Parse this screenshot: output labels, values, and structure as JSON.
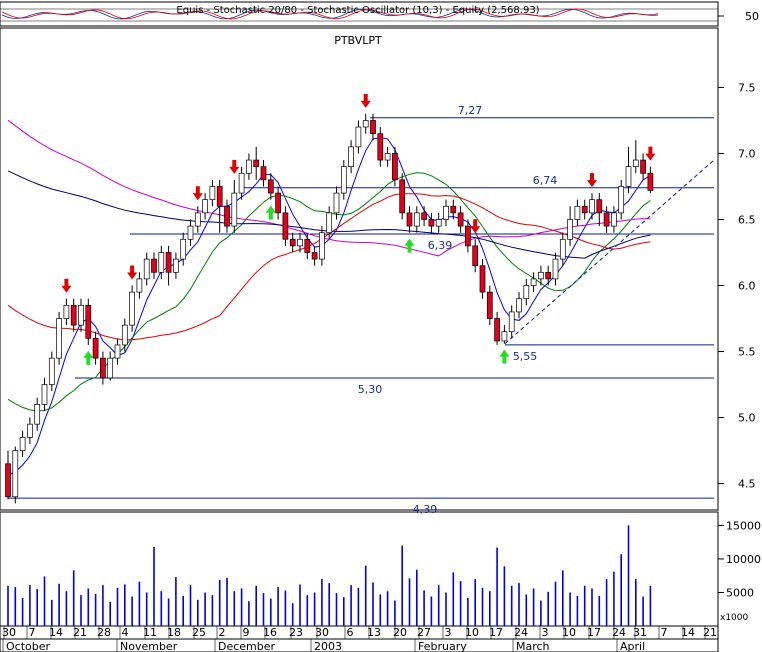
{
  "header": {
    "indicator_text": "Equis - Stochastic 20/80 - Stochastic Oscillator (10,3) - Equity (2,568.93)",
    "security": "PTBVLPT"
  },
  "colors": {
    "background": "#ffffff",
    "bull": "#ffffff",
    "bear": "#e3001b",
    "frame": "#000000",
    "level_line": "#0b1a9e",
    "volume": "#0000e0",
    "ma_fast": "#0000ff",
    "ma_mid": "#008000",
    "ma_slow": "#e00000",
    "ma_200": "#cc00cc",
    "ma_navy": "#000066",
    "arrow_buy": "#22dd22",
    "arrow_sell": "#e00000"
  },
  "chart_data": {
    "type": "candlestick",
    "title": "PTBVLPT",
    "y_axis": {
      "ticks": [
        4.5,
        5.0,
        5.5,
        6.0,
        6.5,
        7.0,
        7.5
      ],
      "labels": [
        "4.5",
        "5.0",
        "5.5",
        "6.0",
        "6.5",
        "7.0",
        "7.5"
      ],
      "range": [
        4.3,
        7.95
      ]
    },
    "oscillator_axis": {
      "ticks": [
        50
      ],
      "labels": [
        "50"
      ]
    },
    "volume_axis": {
      "ticks": [
        5000,
        10000,
        15000
      ],
      "labels": [
        "5000",
        "10000",
        "15000"
      ],
      "unit_label": "x1000",
      "range": [
        0,
        17000
      ]
    },
    "x_axis": {
      "day_labels": [
        "30",
        "7",
        "14",
        "21",
        "28",
        "4",
        "11",
        "18",
        "25",
        "2",
        "9",
        "16",
        "23",
        "30",
        "6",
        "13",
        "20",
        "27",
        "3",
        "10",
        "17",
        "24",
        "3",
        "10",
        "17",
        "24",
        "31",
        "7",
        "14",
        "21"
      ],
      "month_labels": [
        "October",
        "November",
        "December",
        "2003",
        "February",
        "March",
        "April"
      ]
    },
    "levels": [
      {
        "label": "7,27",
        "value": 7.27
      },
      {
        "label": "6,74",
        "value": 6.74
      },
      {
        "label": "6,39",
        "value": 6.39
      },
      {
        "label": "5,55",
        "value": 5.55
      },
      {
        "label": "5,30",
        "value": 5.3
      },
      {
        "label": "4,39",
        "value": 4.39
      }
    ],
    "candles": [
      [
        4.65,
        4.4,
        4.75,
        4.38
      ],
      [
        4.4,
        4.75,
        4.78,
        4.35
      ],
      [
        4.75,
        4.85,
        4.9,
        4.7
      ],
      [
        4.85,
        4.95,
        5.0,
        4.8
      ],
      [
        4.95,
        5.1,
        5.15,
        4.9
      ],
      [
        5.1,
        5.25,
        5.3,
        5.05
      ],
      [
        5.25,
        5.45,
        5.5,
        5.2
      ],
      [
        5.45,
        5.75,
        5.8,
        5.4
      ],
      [
        5.75,
        5.85,
        5.9,
        5.7
      ],
      [
        5.85,
        5.7,
        5.9,
        5.65
      ],
      [
        5.7,
        5.85,
        5.9,
        5.65
      ],
      [
        5.85,
        5.6,
        5.9,
        5.55
      ],
      [
        5.6,
        5.45,
        5.65,
        5.4
      ],
      [
        5.45,
        5.3,
        5.5,
        5.25
      ],
      [
        5.3,
        5.45,
        5.5,
        5.28
      ],
      [
        5.45,
        5.55,
        5.6,
        5.4
      ],
      [
        5.55,
        5.7,
        5.75,
        5.5
      ],
      [
        5.7,
        5.95,
        6.0,
        5.65
      ],
      [
        5.95,
        6.05,
        6.1,
        5.9
      ],
      [
        6.05,
        6.2,
        6.25,
        6.0
      ],
      [
        6.2,
        6.1,
        6.25,
        6.05
      ],
      [
        6.1,
        6.25,
        6.3,
        6.05
      ],
      [
        6.25,
        6.1,
        6.3,
        6.0
      ],
      [
        6.1,
        6.2,
        6.25,
        6.05
      ],
      [
        6.2,
        6.35,
        6.4,
        6.15
      ],
      [
        6.35,
        6.45,
        6.5,
        6.3
      ],
      [
        6.45,
        6.55,
        6.6,
        6.4
      ],
      [
        6.55,
        6.65,
        6.7,
        6.5
      ],
      [
        6.65,
        6.75,
        6.8,
        6.6
      ],
      [
        6.75,
        6.6,
        6.8,
        6.4
      ],
      [
        6.6,
        6.45,
        6.65,
        6.4
      ],
      [
        6.45,
        6.7,
        6.8,
        6.4
      ],
      [
        6.7,
        6.85,
        6.9,
        6.65
      ],
      [
        6.85,
        6.95,
        7.0,
        6.8
      ],
      [
        6.95,
        6.9,
        7.05,
        6.8
      ],
      [
        6.9,
        6.8,
        6.95,
        6.75
      ],
      [
        6.8,
        6.7,
        6.85,
        6.65
      ],
      [
        6.7,
        6.55,
        6.75,
        6.5
      ],
      [
        6.55,
        6.35,
        6.6,
        6.3
      ],
      [
        6.35,
        6.3,
        6.4,
        6.25
      ],
      [
        6.3,
        6.35,
        6.4,
        6.25
      ],
      [
        6.35,
        6.25,
        6.4,
        6.2
      ],
      [
        6.25,
        6.2,
        6.3,
        6.15
      ],
      [
        6.2,
        6.4,
        6.45,
        6.15
      ],
      [
        6.4,
        6.55,
        6.6,
        6.35
      ],
      [
        6.55,
        6.7,
        6.75,
        6.5
      ],
      [
        6.7,
        6.9,
        6.95,
        6.65
      ],
      [
        6.9,
        7.05,
        7.1,
        6.85
      ],
      [
        7.05,
        7.2,
        7.25,
        7.0
      ],
      [
        7.2,
        7.25,
        7.3,
        7.15
      ],
      [
        7.25,
        7.15,
        7.3,
        7.1
      ],
      [
        7.15,
        6.95,
        7.2,
        6.9
      ],
      [
        6.95,
        7.0,
        7.05,
        6.9
      ],
      [
        7.0,
        6.8,
        7.05,
        6.75
      ],
      [
        6.8,
        6.55,
        6.85,
        6.5
      ],
      [
        6.55,
        6.45,
        6.6,
        6.4
      ],
      [
        6.45,
        6.55,
        6.6,
        6.4
      ],
      [
        6.55,
        6.5,
        6.6,
        6.45
      ],
      [
        6.5,
        6.45,
        6.55,
        6.4
      ],
      [
        6.45,
        6.5,
        6.55,
        6.4
      ],
      [
        6.5,
        6.6,
        6.65,
        6.45
      ],
      [
        6.6,
        6.55,
        6.65,
        6.5
      ],
      [
        6.55,
        6.45,
        6.6,
        6.4
      ],
      [
        6.45,
        6.3,
        6.5,
        6.25
      ],
      [
        6.3,
        6.15,
        6.35,
        6.1
      ],
      [
        6.15,
        5.95,
        6.2,
        5.9
      ],
      [
        5.95,
        5.75,
        6.0,
        5.7
      ],
      [
        5.75,
        5.58,
        5.8,
        5.55
      ],
      [
        5.58,
        5.65,
        5.7,
        5.56
      ],
      [
        5.65,
        5.8,
        5.85,
        5.6
      ],
      [
        5.8,
        5.9,
        5.95,
        5.75
      ],
      [
        5.9,
        6.0,
        6.05,
        5.85
      ],
      [
        6.0,
        6.05,
        6.1,
        5.95
      ],
      [
        6.05,
        6.1,
        6.15,
        6.0
      ],
      [
        6.1,
        6.05,
        6.15,
        6.0
      ],
      [
        6.05,
        6.2,
        6.25,
        6.0
      ],
      [
        6.2,
        6.35,
        6.4,
        6.15
      ],
      [
        6.35,
        6.5,
        6.6,
        6.3
      ],
      [
        6.5,
        6.6,
        6.65,
        6.45
      ],
      [
        6.6,
        6.55,
        6.65,
        6.5
      ],
      [
        6.55,
        6.65,
        6.7,
        6.5
      ],
      [
        6.65,
        6.55,
        6.7,
        6.45
      ],
      [
        6.55,
        6.45,
        6.6,
        6.4
      ],
      [
        6.45,
        6.55,
        6.6,
        6.4
      ],
      [
        6.55,
        6.75,
        6.8,
        6.5
      ],
      [
        6.75,
        6.9,
        7.05,
        6.7
      ],
      [
        6.9,
        6.95,
        7.1,
        6.85
      ],
      [
        6.95,
        6.85,
        7.0,
        6.8
      ],
      [
        6.85,
        6.72,
        6.9,
        6.7
      ]
    ],
    "volumes": [
      6000,
      5800,
      4200,
      6100,
      5500,
      7400,
      3900,
      6300,
      5200,
      8300,
      4600,
      5600,
      4800,
      6100,
      3600,
      5700,
      6200,
      4400,
      6600,
      5000,
      11800,
      5200,
      4100,
      7300,
      4500,
      6100,
      3900,
      5000,
      4600,
      6900,
      7200,
      5200,
      5600,
      3700,
      6000,
      4900,
      4100,
      5800,
      5300,
      3400,
      6200,
      4600,
      5000,
      7000,
      6400,
      4900,
      4300,
      6100,
      5700,
      9000,
      6500,
      4700,
      5200,
      3800,
      12000,
      7100,
      8400,
      5300,
      4400,
      6100,
      5000,
      8000,
      6700,
      4200,
      7000,
      5700,
      5200,
      11700,
      8900,
      6000,
      6400,
      4700,
      5600,
      3800,
      5100,
      6600,
      8300,
      5000,
      4500,
      6000,
      5600,
      4500,
      7000,
      8100,
      10700,
      15000,
      7000,
      4400,
      6000
    ]
  }
}
